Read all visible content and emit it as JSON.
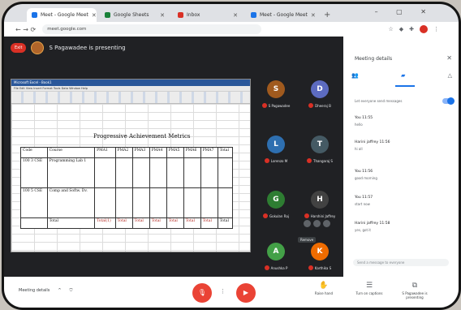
{
  "browser": {
    "tabs": [
      {
        "label": "Meet - Google Meet",
        "active": true
      },
      {
        "label": "Google Sheets",
        "active": false
      },
      {
        "label": "Inbox",
        "active": false
      },
      {
        "label": "Meet - Google Meet",
        "active": false
      }
    ],
    "new_tab": "+",
    "window_controls": "– ▢ ✕",
    "address": "meet.google.com",
    "nav_icons": "← → ⟳"
  },
  "stage": {
    "back_label": "Exit",
    "presenter_label": "S Pagawadee is presenting"
  },
  "spreadsheet": {
    "window_title": "Microsoft Excel - Book1",
    "menu": "File  Edit  View  Insert  Format  Tools  Data  Window  Help",
    "title": "Progressive Achievement Metrics",
    "headers": [
      "Code",
      "Course",
      "PMA1",
      "PMA2",
      "PMA3",
      "PMA4",
      "PMA5",
      "PMA6",
      "PMA7",
      "Total"
    ],
    "rows": [
      {
        "code": "100 3 CSE",
        "course": "Programming Lab 1",
        "cells": [
          "",
          "",
          "",
          "",
          "",
          "",
          "",
          ""
        ]
      },
      {
        "code": "100 5 CSE",
        "course": "Comp and Softw. Dv.",
        "cells": [
          "",
          "",
          "",
          "",
          "",
          "",
          "",
          ""
        ]
      }
    ],
    "total_row": [
      "",
      "Total",
      "Total(1)",
      "Total",
      "Total",
      "Total",
      "Total",
      "Total",
      "Total",
      "Total"
    ]
  },
  "participants": [
    {
      "initial": "S",
      "name": "S Pagawadee",
      "color": "#a05a1e"
    },
    {
      "initial": "D",
      "name": "Dheeraj B",
      "color": "#5c6bc0"
    },
    {
      "initial": "L",
      "name": "Lorenzo M",
      "color": "#2e6fb0"
    },
    {
      "initial": "T",
      "name": "Thangaraj S",
      "color": "#455a64"
    },
    {
      "initial": "G",
      "name": "Gokulan Raj",
      "color": "#2e7d32"
    },
    {
      "initial": "H",
      "name": "Harshini Jaffrey",
      "color": "#424242"
    },
    {
      "initial": "A",
      "name": "Anushka P",
      "color": "#43a047"
    },
    {
      "initial": "K",
      "name": "Karthika S",
      "color": "#ef6c00"
    }
  ],
  "hover_tooltip": "Remove",
  "side_panel": {
    "title": "Meeting details",
    "close": "✕",
    "tabs": [
      "People",
      "Chat",
      "Activities"
    ],
    "toggle_label": "Let everyone send messages",
    "messages": [
      {
        "who": "You  11:55",
        "text": "hello"
      },
      {
        "who": "Harini jaffrey  11:56",
        "text": "hi all"
      },
      {
        "who": "You  11:56",
        "text": "good morning"
      },
      {
        "who": "You  11:57",
        "text": "start now"
      },
      {
        "who": "Harini jaffrey  11:58",
        "text": "yes, got it"
      }
    ],
    "input_placeholder": "Send a message to everyone"
  },
  "bottom_bar": {
    "meeting_details": "Meeting details",
    "meeting_chevron": "^",
    "mic_label": "🎙",
    "cam_label": "▶",
    "more": "⋮",
    "actions": [
      {
        "icon": "✋",
        "label": "Raise hand"
      },
      {
        "icon": "☰",
        "label": "Turn on captions"
      },
      {
        "icon": "⧉",
        "label": "S Pagawadee is presenting"
      }
    ]
  }
}
